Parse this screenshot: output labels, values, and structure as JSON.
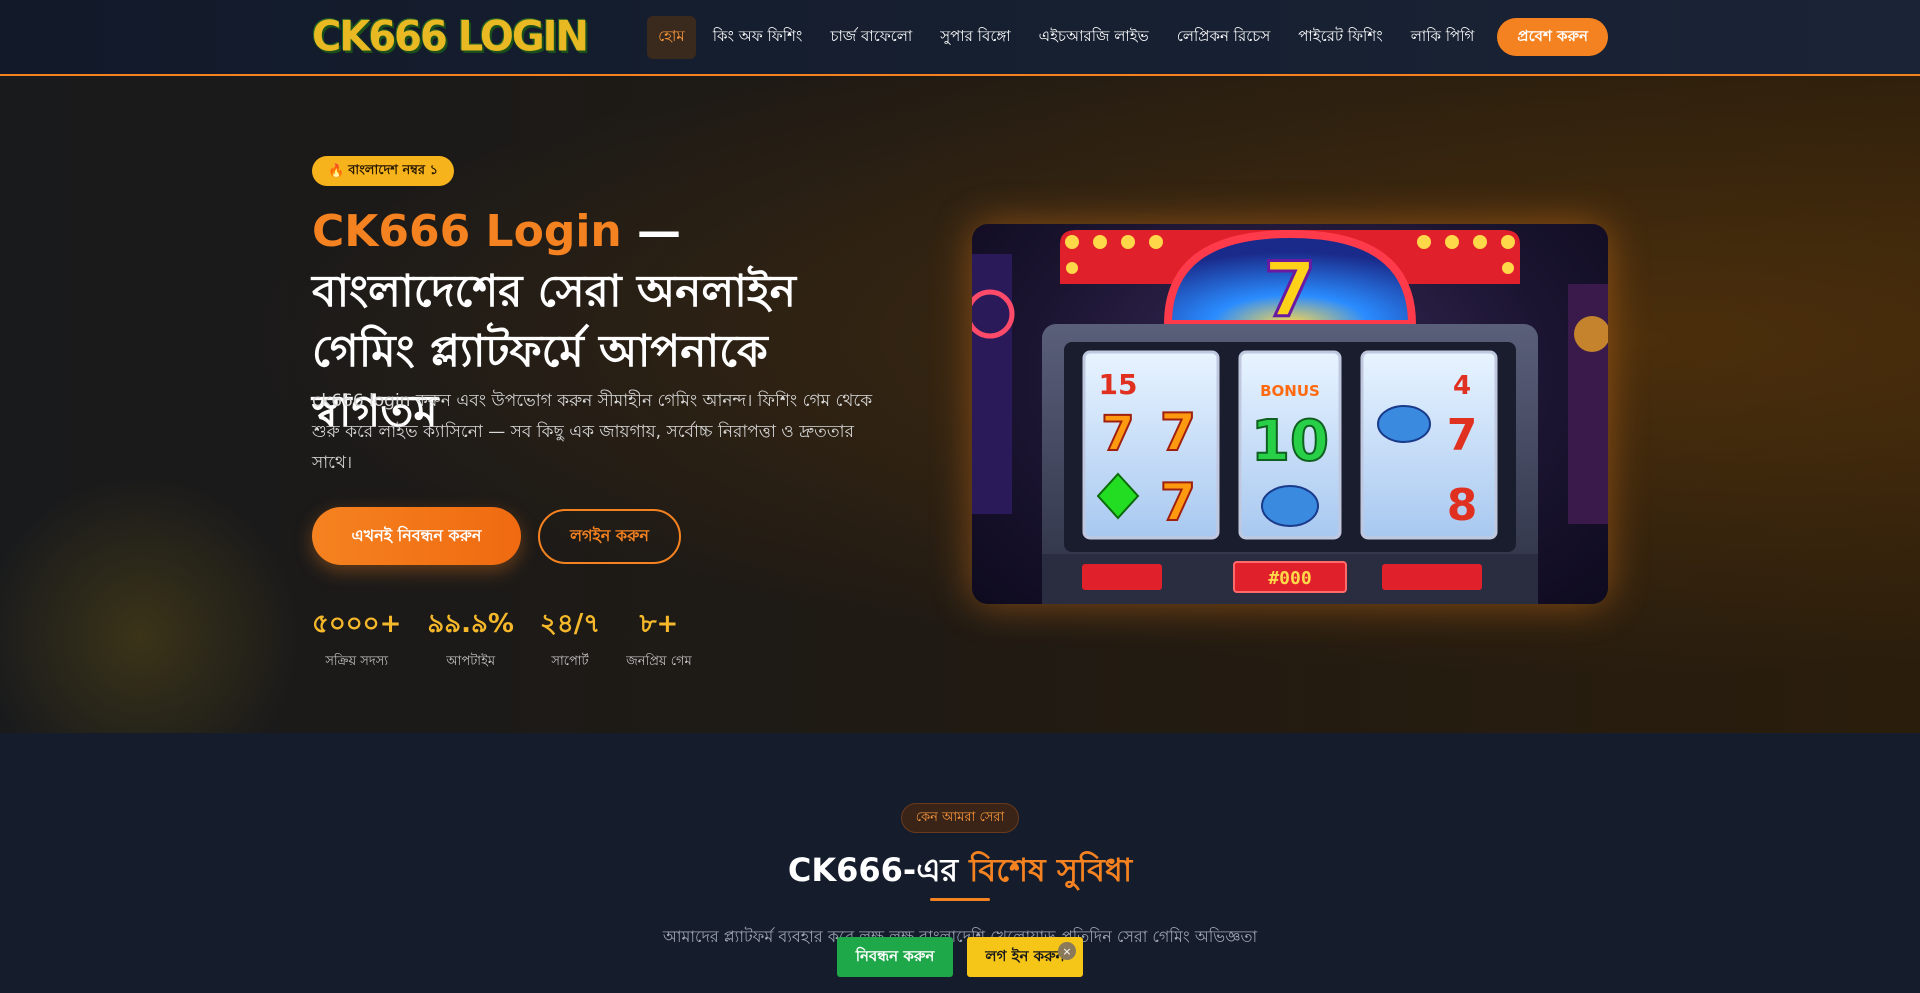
{
  "header": {
    "logo": "CK666 LOGIN",
    "nav": [
      {
        "label": "হোম",
        "active": true
      },
      {
        "label": "কিং অফ ফিশিং",
        "active": false
      },
      {
        "label": "চার্জ বাফেলো",
        "active": false
      },
      {
        "label": "সুপার বিঙ্গো",
        "active": false
      },
      {
        "label": "এইচআরজি লাইভ",
        "active": false
      },
      {
        "label": "লেপ্রিকন রিচেস",
        "active": false
      },
      {
        "label": "পাইরেট ফিশিং",
        "active": false
      },
      {
        "label": "লাকি পিগি",
        "active": false
      }
    ],
    "enter_button": "প্রবেশ করুন",
    "accent_color": "#f58220"
  },
  "hero": {
    "badge_icon": "fire-icon",
    "badge_text": "বাংলাদেশ নম্বর ১",
    "title_accent": "CK666 Login",
    "title_rest": " — বাংলাদেশের সেরা অনলাইন গেমিং প্ল্যাটফর্মে আপনাকে স্বাগতম",
    "description": "ck666 login করুন এবং উপভোগ করুন সীমাহীন গেমিং আনন্দ। ফিশিং গেম থেকে শুরু করে লাইভ ক্যাসিনো — সব কিছু এক জায়গায়, সর্বোচ্চ নিরাপত্তা ও দ্রুততার সাথে।",
    "register_button": "এখনই নিবন্ধন করুন",
    "login_button": "লগইন করুন",
    "stats": [
      {
        "value": "৫০০০+",
        "label": "সক্রিয় সদস্য"
      },
      {
        "value": "৯৯.৯%",
        "label": "আপটাইম"
      },
      {
        "value": "২৪/৭",
        "label": "সাপোর্ট"
      },
      {
        "value": "৮+",
        "label": "জনপ্রিয় গেম"
      }
    ],
    "image": {
      "jackpot_digit": "7",
      "reel_labels": [
        "15",
        "7",
        "7",
        "7",
        "10",
        "4",
        "7",
        "8"
      ],
      "bonus_text": "BONUS",
      "display_value": "#000"
    }
  },
  "features": {
    "badge": "কেন আমরা সেরা",
    "title_plain": "CK666-এর ",
    "title_accent": "বিশেষ সুবিধা",
    "description": "আমাদের প্ল্যাটফর্ম ব্যবহার করে লক্ষ লক্ষ বাংলাদেশি খেলোয়াড় প্রতিদিন সেরা গেমিং অভিজ্ঞতা"
  },
  "sticky_bar": {
    "register": "নিবন্ধন করুন",
    "login": "লগ ইন করুন",
    "close": "×"
  }
}
